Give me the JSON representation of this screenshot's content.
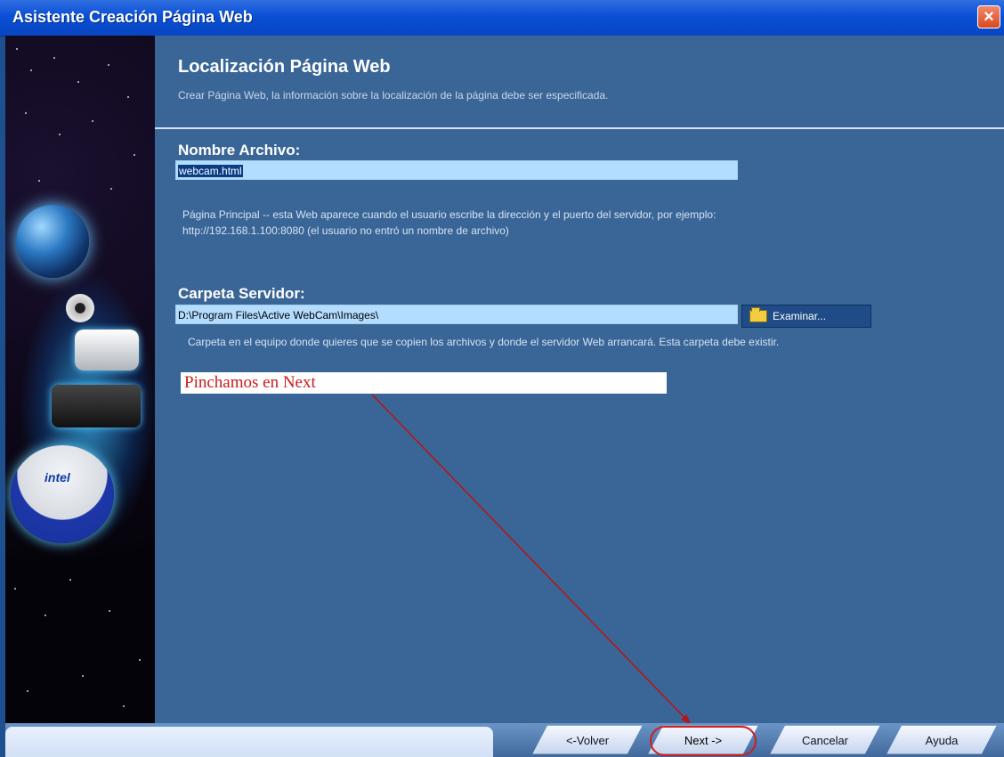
{
  "window": {
    "title": "Asistente Creación Página Web",
    "close_symbol": "×"
  },
  "header": {
    "title": "Localización Página Web",
    "subtitle": "Crear Página Web, la información sobre la localización de la página debe ser especificada."
  },
  "file_section": {
    "label": "Nombre Archivo:",
    "value": "webcam.html",
    "help_line_1": "Página Principal -- esta Web aparece cuando el usuario escribe la dirección y el puerto del servidor, por ejemplo:",
    "help_line_2": "http://192.168.1.100:8080 (el usuario no entró un nombre de archivo)"
  },
  "server_section": {
    "label": "Carpeta Servidor:",
    "value": "D:\\Program Files\\Active WebCam\\Images\\",
    "browse_label": "Examinar...",
    "help_text": "Carpeta en el equipo donde quieres que se copien los archivos y donde el servidor Web arrancará. Esta carpeta debe existir."
  },
  "annotation": {
    "text": "Pinchamos en Next"
  },
  "footer": {
    "back": "<-Volver",
    "next": "Next ->",
    "cancel": "Cancelar",
    "help": "Ayuda"
  },
  "colors": {
    "title_bar": "#0a4fd6",
    "content_bg": "#3a6697",
    "annotation_red": "#cc1a1a"
  },
  "icons": {
    "close": "close-icon",
    "folder": "folder-icon"
  },
  "side_graphic": {
    "logo_text": "intel"
  }
}
